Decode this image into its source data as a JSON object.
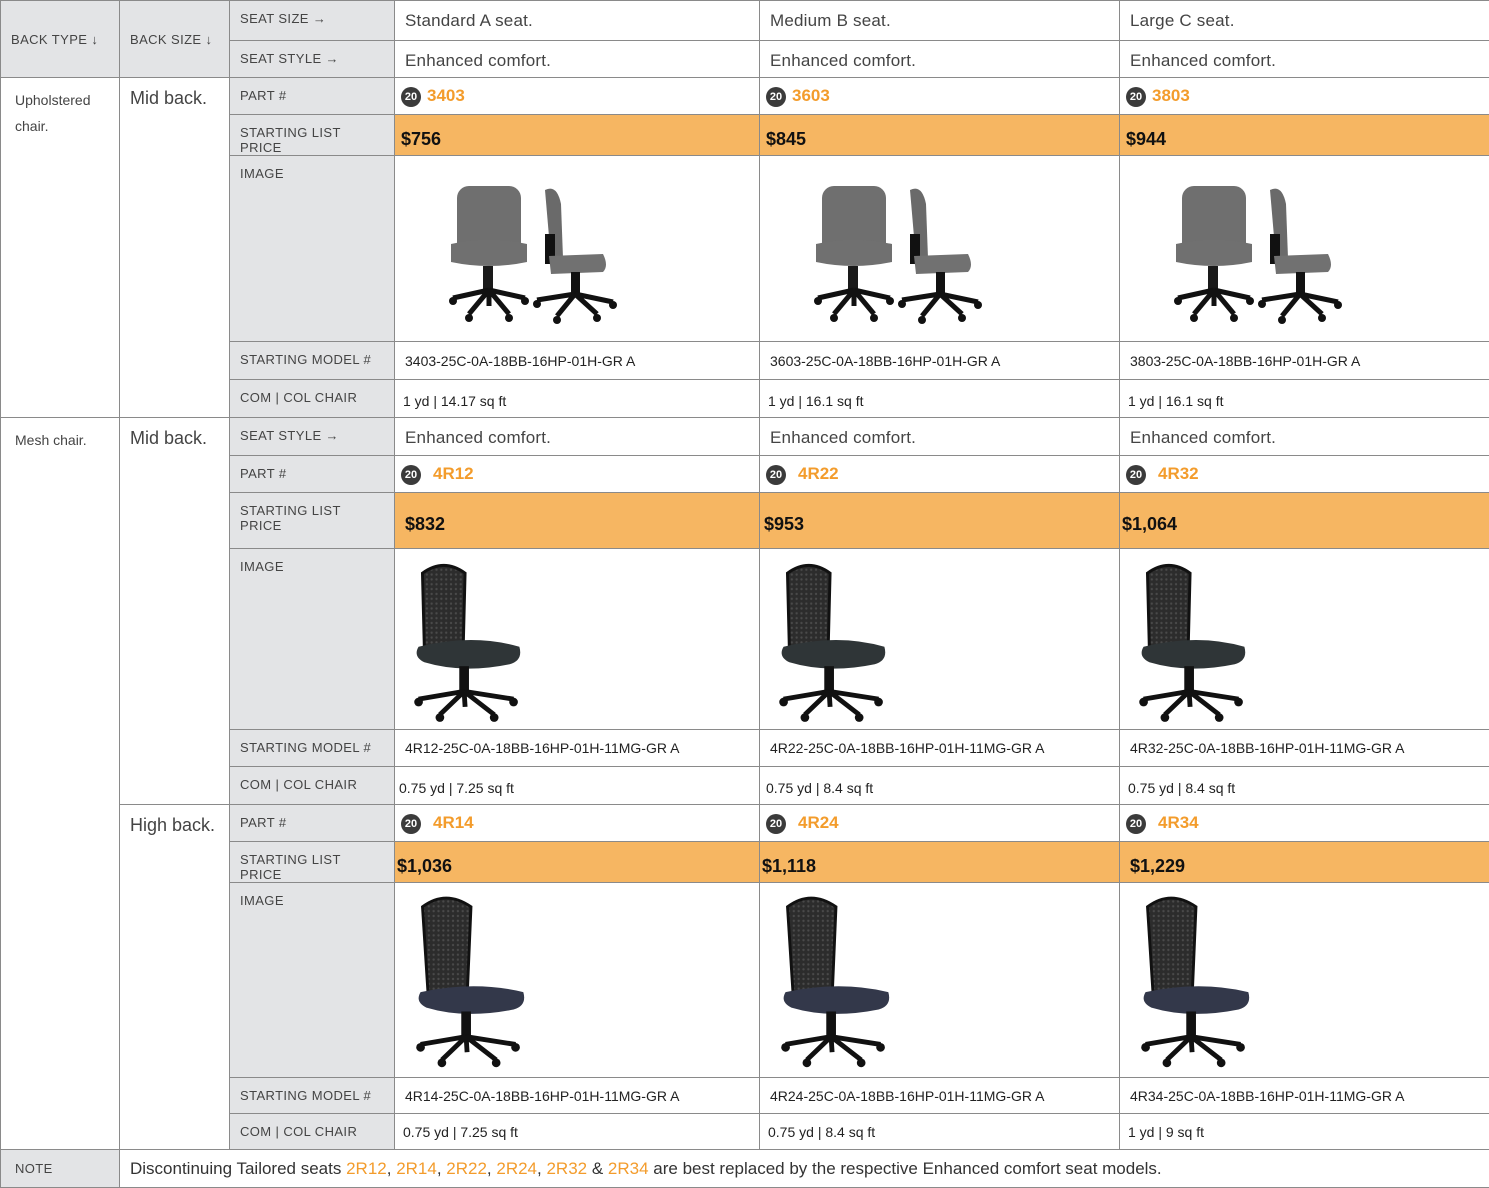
{
  "header": {
    "back_type": "BACK TYPE ↓",
    "back_size": "BACK SIZE ↓",
    "seat_size_label": "SEAT SIZE →",
    "seat_style_label": "SEAT STYLE →",
    "seat_sizes": [
      "Standard A seat.",
      "Medium B seat.",
      "Large C seat."
    ],
    "seat_styles": [
      "Enhanced comfort.",
      "Enhanced comfort.",
      "Enhanced comfort."
    ]
  },
  "labels": {
    "seat_style": "SEAT STYLE →",
    "part": "PART #",
    "price": "STARTING LIST PRICE",
    "image": "IMAGE",
    "model": "STARTING MODEL #",
    "com": "COM | COL CHAIR",
    "note": "NOTE"
  },
  "badge": "20",
  "groups": [
    {
      "back_type": "Upholstered chair.",
      "back_size": "Mid back.",
      "parts": [
        "3403",
        "3603",
        "3803"
      ],
      "prices": [
        "$756",
        "$845",
        "$944"
      ],
      "models": [
        "3403-25C-0A-18BB-16HP-01H-GR A",
        "3603-25C-0A-18BB-16HP-01H-GR A",
        "3803-25C-0A-18BB-16HP-01H-GR A"
      ],
      "com": [
        "1 yd | 14.17 sq ft",
        "1 yd | 16.1 sq ft",
        "1 yd | 16.1 sq ft"
      ],
      "image_icon": "upholstered-chair-pair-icon"
    },
    {
      "back_type": "Mesh chair.",
      "back_size": "Mid back.",
      "seat_styles": [
        "Enhanced comfort.",
        "Enhanced comfort.",
        "Enhanced comfort."
      ],
      "parts": [
        "4R12",
        "4R22",
        "4R32"
      ],
      "prices": [
        "$832",
        "$953",
        "$1,064"
      ],
      "models": [
        "4R12-25C-0A-18BB-16HP-01H-11MG-GR A",
        "4R22-25C-0A-18BB-16HP-01H-11MG-GR A",
        "4R32-25C-0A-18BB-16HP-01H-11MG-GR A"
      ],
      "com": [
        "0.75 yd | 7.25 sq ft",
        "0.75 yd | 8.4 sq ft",
        "0.75 yd | 8.4 sq ft"
      ],
      "image_icon": "mesh-mid-back-chair-icon"
    },
    {
      "back_size": "High back.",
      "parts": [
        "4R14",
        "4R24",
        "4R34"
      ],
      "prices": [
        "$1,036",
        "$1,118",
        "$1,229"
      ],
      "models": [
        "4R14-25C-0A-18BB-16HP-01H-11MG-GR A",
        "4R24-25C-0A-18BB-16HP-01H-11MG-GR A",
        "4R34-25C-0A-18BB-16HP-01H-11MG-GR A"
      ],
      "com": [
        "0.75 yd | 7.25 sq ft",
        "0.75 yd | 8.4 sq ft",
        "1 yd | 9 sq ft"
      ],
      "image_icon": "mesh-high-back-chair-icon"
    }
  ],
  "note": {
    "prefix": "Discontinuing Tailored seats ",
    "codes": [
      "2R12",
      "2R14",
      "2R22",
      "2R24",
      "2R32",
      "2R34"
    ],
    "sep1": ", ",
    "sep2": ", ",
    "sep3": ", ",
    "sep4": ", ",
    "amp": " & ",
    "suffix": " are best replaced by the respective Enhanced comfort seat models."
  },
  "colors": {
    "price_band": "#f6b662",
    "part_number": "#f39c2c",
    "label_column": "#e3e4e6",
    "badge": "#3b3b3b"
  }
}
